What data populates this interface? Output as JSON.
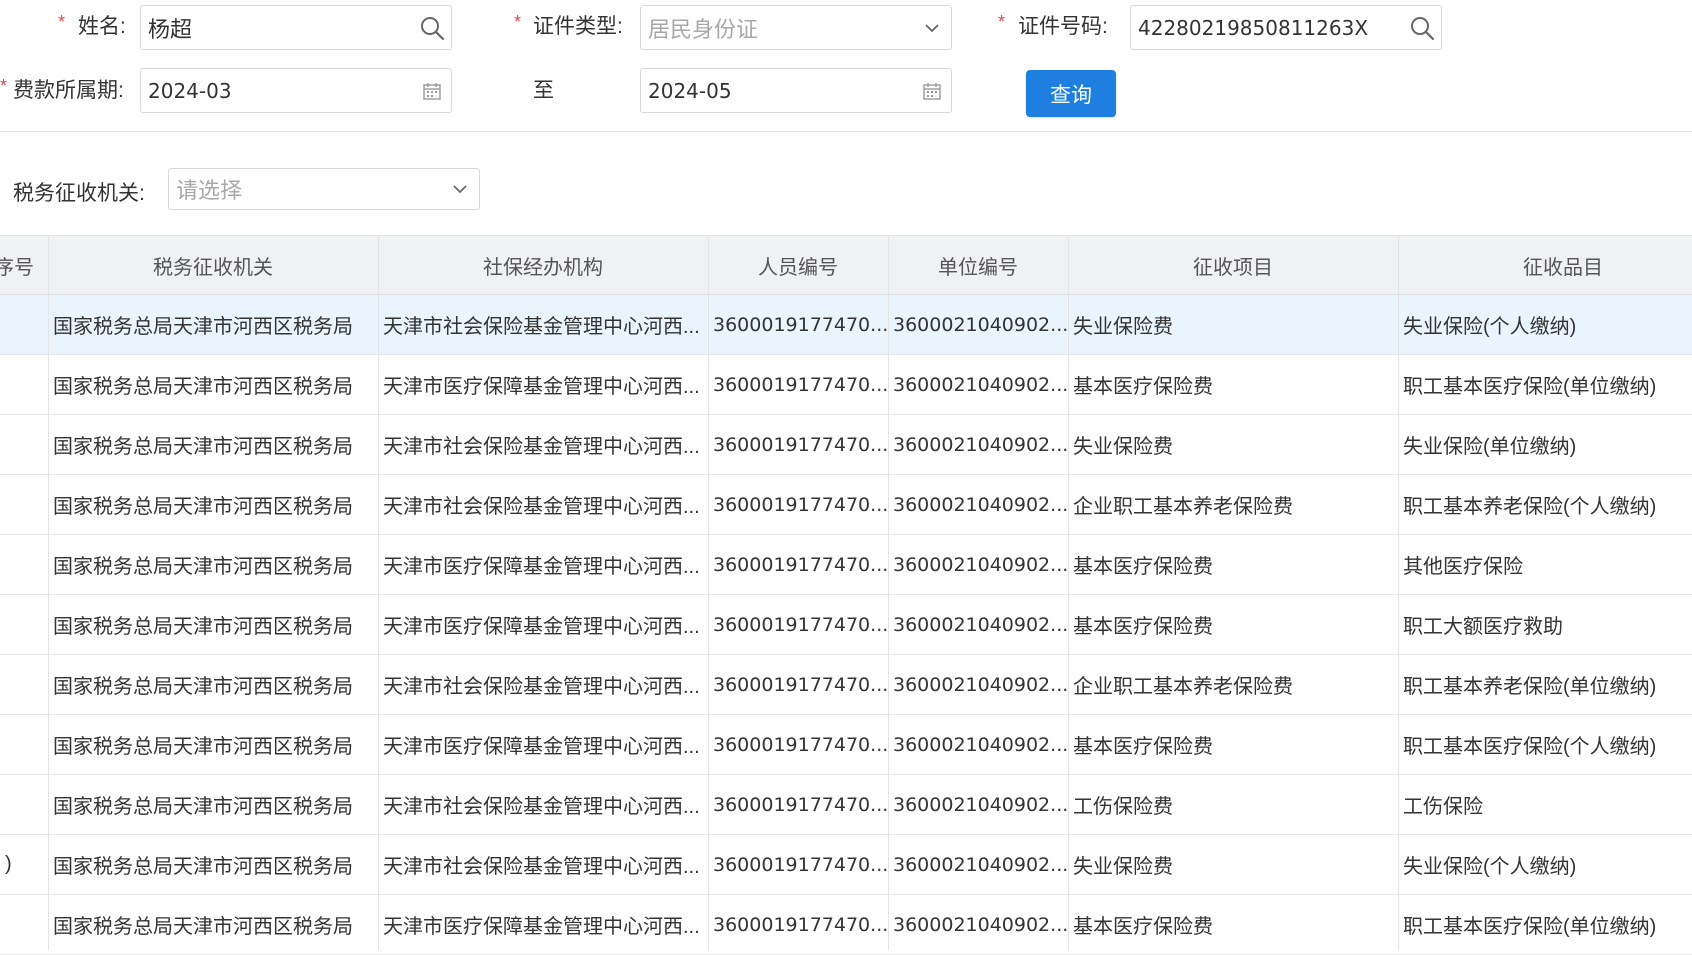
{
  "form": {
    "name_label": "姓名:",
    "name_value": "杨超",
    "idtype_label": "证件类型:",
    "idtype_placeholder": "居民身份证",
    "idno_label": "证件号码:",
    "idno_value": "42280219850811263X",
    "period_label": "费款所属期:",
    "period_from": "2024-03",
    "period_sep": "至",
    "period_to": "2024-05",
    "query_label": "查询",
    "tax_office_label": "税务征收机关:",
    "tax_office_placeholder": "请选择",
    "required_mark": "*"
  },
  "table": {
    "headers": [
      "序号",
      "税务征收机关",
      "社保经办机构",
      "人员编号",
      "单位编号",
      "征收项目",
      "征收品目"
    ],
    "index_fragments": [
      "",
      "",
      "",
      "",
      "",
      "",
      "",
      "",
      "",
      ")",
      ""
    ],
    "rows": [
      [
        "国家税务总局天津市河西区税务局",
        "天津市社会保险基金管理中心河西...",
        "3600019177470...",
        "3600021040902...",
        "失业保险费",
        "失业保险(个人缴纳)"
      ],
      [
        "国家税务总局天津市河西区税务局",
        "天津市医疗保障基金管理中心河西...",
        "3600019177470...",
        "3600021040902...",
        "基本医疗保险费",
        "职工基本医疗保险(单位缴纳)"
      ],
      [
        "国家税务总局天津市河西区税务局",
        "天津市社会保险基金管理中心河西...",
        "3600019177470...",
        "3600021040902...",
        "失业保险费",
        "失业保险(单位缴纳)"
      ],
      [
        "国家税务总局天津市河西区税务局",
        "天津市社会保险基金管理中心河西...",
        "3600019177470...",
        "3600021040902...",
        "企业职工基本养老保险费",
        "职工基本养老保险(个人缴纳)"
      ],
      [
        "国家税务总局天津市河西区税务局",
        "天津市医疗保障基金管理中心河西...",
        "3600019177470...",
        "3600021040902...",
        "基本医疗保险费",
        "其他医疗保险"
      ],
      [
        "国家税务总局天津市河西区税务局",
        "天津市医疗保障基金管理中心河西...",
        "3600019177470...",
        "3600021040902...",
        "基本医疗保险费",
        "职工大额医疗救助"
      ],
      [
        "国家税务总局天津市河西区税务局",
        "天津市社会保险基金管理中心河西...",
        "3600019177470...",
        "3600021040902...",
        "企业职工基本养老保险费",
        "职工基本养老保险(单位缴纳)"
      ],
      [
        "国家税务总局天津市河西区税务局",
        "天津市医疗保障基金管理中心河西...",
        "3600019177470...",
        "3600021040902...",
        "基本医疗保险费",
        "职工基本医疗保险(个人缴纳)"
      ],
      [
        "国家税务总局天津市河西区税务局",
        "天津市社会保险基金管理中心河西...",
        "3600019177470...",
        "3600021040902...",
        "工伤保险费",
        "工伤保险"
      ],
      [
        "国家税务总局天津市河西区税务局",
        "天津市社会保险基金管理中心河西...",
        "3600019177470...",
        "3600021040902...",
        "失业保险费",
        "失业保险(个人缴纳)"
      ],
      [
        "国家税务总局天津市河西区税务局",
        "天津市医疗保障基金管理中心河西...",
        "3600019177470...",
        "3600021040902...",
        "基本医疗保险费",
        "职工基本医疗保险(单位缴纳)"
      ]
    ]
  },
  "colors": {
    "accent": "#1f7fe0",
    "required": "#e64545",
    "selected_row": "#eaf4fd",
    "header_bg": "#f0f1f3"
  },
  "icons": {
    "name_search": "search-icon",
    "id_search": "search-icon",
    "idtype_dropdown": "chevron-down-icon",
    "period_from_picker": "calendar-icon",
    "period_to_picker": "calendar-icon",
    "tax_office_dropdown": "chevron-down-icon"
  }
}
